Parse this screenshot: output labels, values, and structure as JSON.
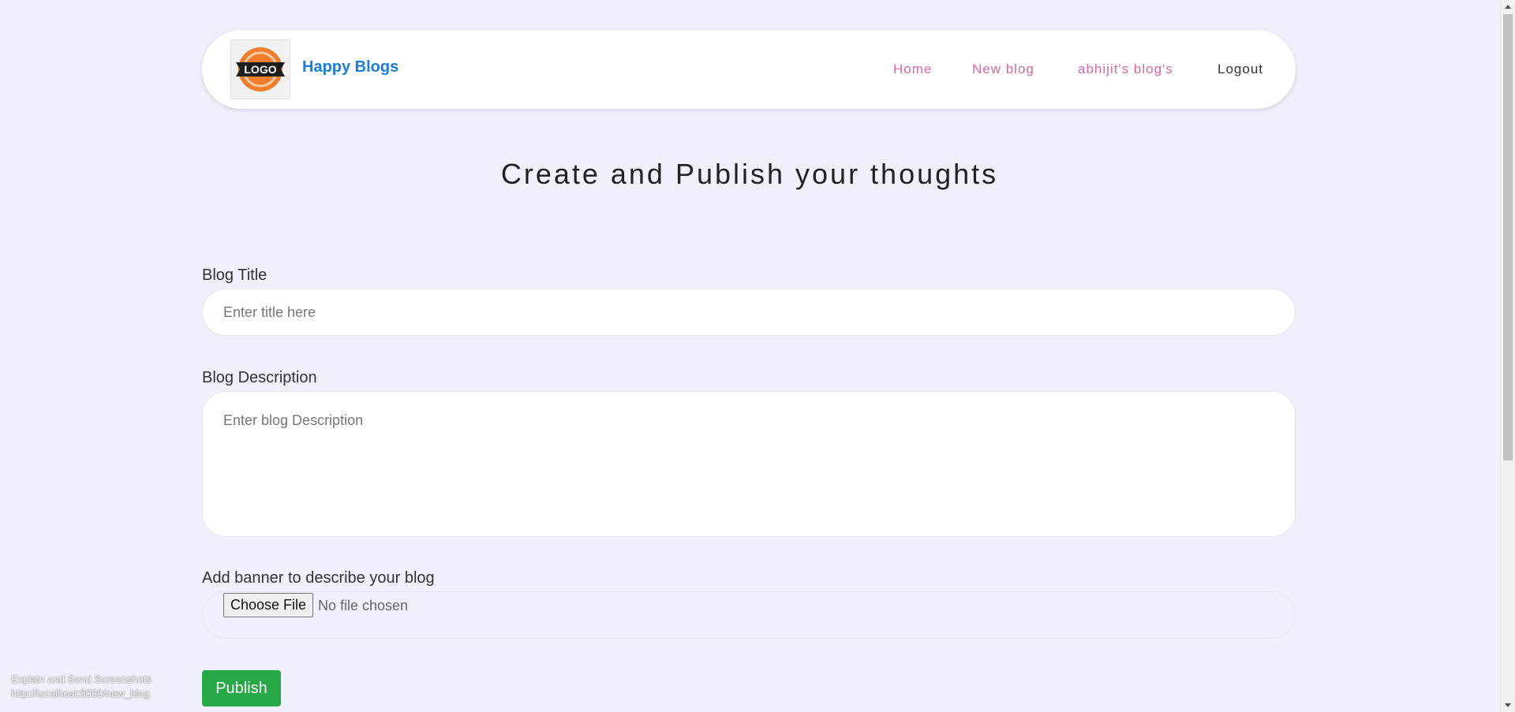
{
  "navbar": {
    "logo_text": "LOGO",
    "brand": "Happy Blogs",
    "links": [
      {
        "label": "Home"
      },
      {
        "label": "New blog"
      },
      {
        "label": "abhijit's blog's"
      },
      {
        "label": "Logout"
      }
    ]
  },
  "main": {
    "heading": "Create and Publish your thoughts",
    "title_label": "Blog Title",
    "title_placeholder": "Enter title here",
    "title_value": "",
    "desc_label": "Blog Description",
    "desc_placeholder": "Enter blog Description",
    "desc_value": "",
    "banner_label": "Add banner to describe your blog",
    "choose_file_label": "Choose File",
    "file_status": "No file chosen",
    "publish_label": "Publish"
  },
  "overlay": {
    "line1": "Explain and Send Screenshots",
    "line2": "http://localhost:8000/new_blog"
  },
  "colors": {
    "background": "#f0f0fc",
    "brand": "#1a7fd4",
    "nav_link": "#d36aa6",
    "publish": "#28a745",
    "logo_orange": "#f07d2e"
  },
  "icons": {
    "logo": "logo-badge-icon",
    "scroll_up": "scroll-up-arrow-icon",
    "scroll_down": "scroll-down-arrow-icon"
  }
}
